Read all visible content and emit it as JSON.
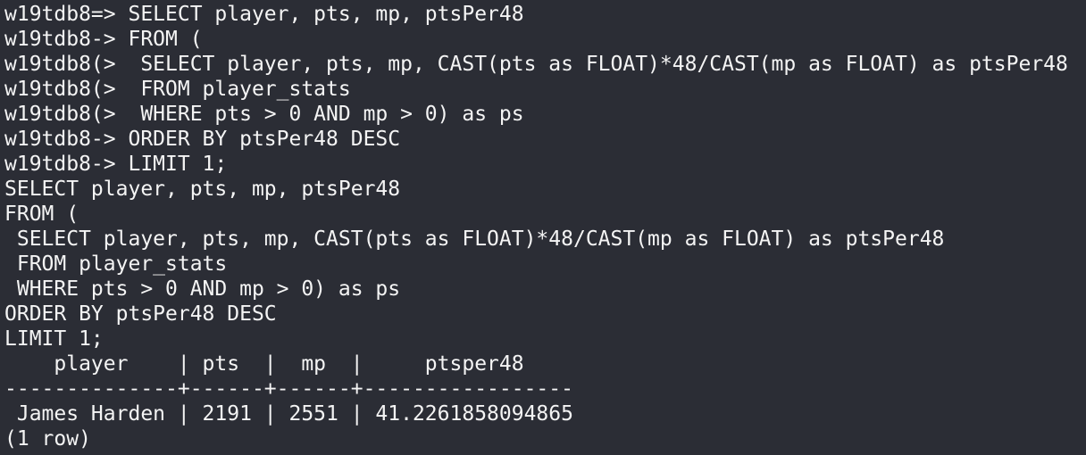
{
  "terminal": {
    "lines": [
      "w19tdb8=> SELECT player, pts, mp, ptsPer48",
      "w19tdb8-> FROM (",
      "w19tdb8(>  SELECT player, pts, mp, CAST(pts as FLOAT)*48/CAST(mp as FLOAT) as ptsPer48",
      "w19tdb8(>  FROM player_stats",
      "w19tdb8(>  WHERE pts > 0 AND mp > 0) as ps",
      "w19tdb8-> ORDER BY ptsPer48 DESC",
      "w19tdb8-> LIMIT 1;",
      "SELECT player, pts, mp, ptsPer48",
      "FROM (",
      " SELECT player, pts, mp, CAST(pts as FLOAT)*48/CAST(mp as FLOAT) as ptsPer48",
      " FROM player_stats",
      " WHERE pts > 0 AND mp > 0) as ps",
      "ORDER BY ptsPer48 DESC",
      "LIMIT 1;",
      "    player    | pts  |  mp  |     ptsper48",
      "--------------+------+------+-----------------",
      " James Harden | 2191 | 2551 | 41.2261858094865",
      "(1 row)"
    ]
  }
}
